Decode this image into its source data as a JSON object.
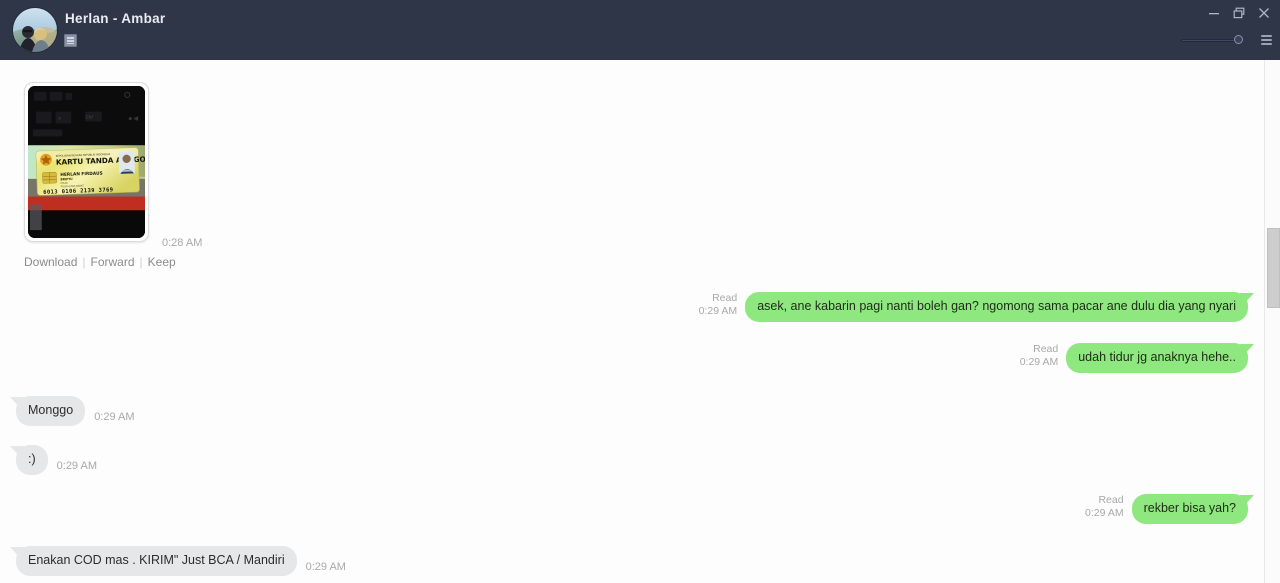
{
  "window": {
    "title": "Herlan - Ambar",
    "note_icon": "note-window-icon",
    "minimize_label": "—",
    "restore_label": "❐",
    "close_label": "✕",
    "menu_icon": "hamburger-menu-icon",
    "caret_icon": "chevron-down-icon",
    "slider_icon": "volume-slider",
    "colors": {
      "titlebar": "#2e3648",
      "outgoing_bubble": "#8fe87f",
      "incoming_bubble": "#e6e7e9",
      "body": "#fdfdfd",
      "muted_text": "#a9a9a9"
    }
  },
  "image_message": {
    "time": "0:28 AM",
    "actions": {
      "download": "Download",
      "forward": "Forward",
      "keep": "Keep",
      "separator": "|"
    },
    "card": {
      "issuer": "KEPOLISIAN NEGARA REPUBLIK INDONESIA",
      "title": "KARTU TANDA ANGGOTA",
      "name": "HERLAN FIRDAUS",
      "rank": "BRIPTU",
      "unit": "POLDA JAWA BARAT",
      "number": "6013 0106 2139 3769"
    }
  },
  "messages": [
    {
      "id": "m1",
      "side": "out",
      "text": "asek, ane kabarin pagi nanti boleh gan? ngomong sama pacar ane dulu dia yang nyari",
      "status": "Read",
      "time": "0:29 AM"
    },
    {
      "id": "m2",
      "side": "out",
      "text": "udah tidur jg anaknya hehe..",
      "status": "Read",
      "time": "0:29 AM"
    },
    {
      "id": "m3",
      "side": "in",
      "text": "Monggo",
      "status": "",
      "time": "0:29 AM"
    },
    {
      "id": "m4",
      "side": "in",
      "text": ":)",
      "status": "",
      "time": "0:29 AM"
    },
    {
      "id": "m5",
      "side": "out",
      "text": "rekber bisa yah?",
      "status": "Read",
      "time": "0:29 AM"
    },
    {
      "id": "m6",
      "side": "in",
      "text": "Enakan COD mas . KIRIM\" Just BCA / Mandiri",
      "status": "",
      "time": "0:29 AM"
    }
  ]
}
